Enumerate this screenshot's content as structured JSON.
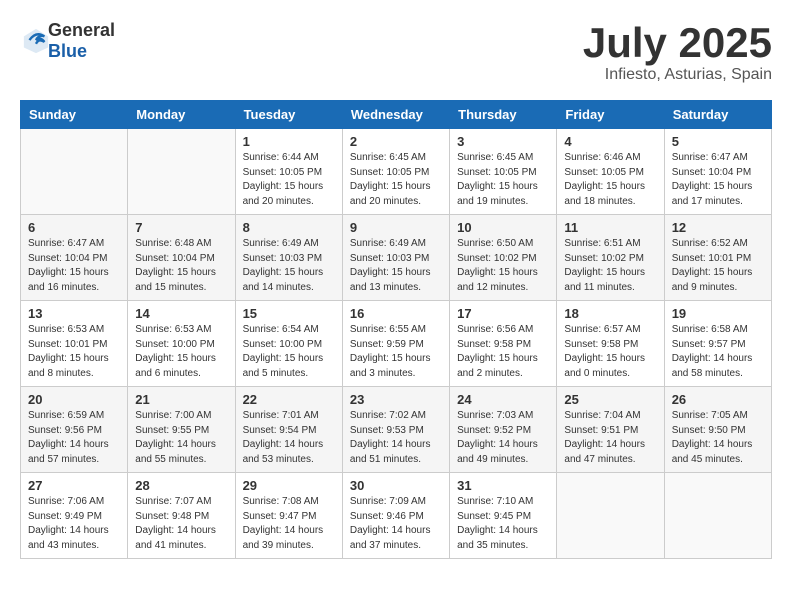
{
  "header": {
    "logo": {
      "text_general": "General",
      "text_blue": "Blue"
    },
    "month": "July 2025",
    "location": "Infiesto, Asturias, Spain"
  },
  "weekdays": [
    "Sunday",
    "Monday",
    "Tuesday",
    "Wednesday",
    "Thursday",
    "Friday",
    "Saturday"
  ],
  "weeks": [
    [
      {
        "day": "",
        "sunrise": "",
        "sunset": "",
        "daylight": ""
      },
      {
        "day": "",
        "sunrise": "",
        "sunset": "",
        "daylight": ""
      },
      {
        "day": "1",
        "sunrise": "Sunrise: 6:44 AM",
        "sunset": "Sunset: 10:05 PM",
        "daylight": "Daylight: 15 hours and 20 minutes."
      },
      {
        "day": "2",
        "sunrise": "Sunrise: 6:45 AM",
        "sunset": "Sunset: 10:05 PM",
        "daylight": "Daylight: 15 hours and 20 minutes."
      },
      {
        "day": "3",
        "sunrise": "Sunrise: 6:45 AM",
        "sunset": "Sunset: 10:05 PM",
        "daylight": "Daylight: 15 hours and 19 minutes."
      },
      {
        "day": "4",
        "sunrise": "Sunrise: 6:46 AM",
        "sunset": "Sunset: 10:05 PM",
        "daylight": "Daylight: 15 hours and 18 minutes."
      },
      {
        "day": "5",
        "sunrise": "Sunrise: 6:47 AM",
        "sunset": "Sunset: 10:04 PM",
        "daylight": "Daylight: 15 hours and 17 minutes."
      }
    ],
    [
      {
        "day": "6",
        "sunrise": "Sunrise: 6:47 AM",
        "sunset": "Sunset: 10:04 PM",
        "daylight": "Daylight: 15 hours and 16 minutes."
      },
      {
        "day": "7",
        "sunrise": "Sunrise: 6:48 AM",
        "sunset": "Sunset: 10:04 PM",
        "daylight": "Daylight: 15 hours and 15 minutes."
      },
      {
        "day": "8",
        "sunrise": "Sunrise: 6:49 AM",
        "sunset": "Sunset: 10:03 PM",
        "daylight": "Daylight: 15 hours and 14 minutes."
      },
      {
        "day": "9",
        "sunrise": "Sunrise: 6:49 AM",
        "sunset": "Sunset: 10:03 PM",
        "daylight": "Daylight: 15 hours and 13 minutes."
      },
      {
        "day": "10",
        "sunrise": "Sunrise: 6:50 AM",
        "sunset": "Sunset: 10:02 PM",
        "daylight": "Daylight: 15 hours and 12 minutes."
      },
      {
        "day": "11",
        "sunrise": "Sunrise: 6:51 AM",
        "sunset": "Sunset: 10:02 PM",
        "daylight": "Daylight: 15 hours and 11 minutes."
      },
      {
        "day": "12",
        "sunrise": "Sunrise: 6:52 AM",
        "sunset": "Sunset: 10:01 PM",
        "daylight": "Daylight: 15 hours and 9 minutes."
      }
    ],
    [
      {
        "day": "13",
        "sunrise": "Sunrise: 6:53 AM",
        "sunset": "Sunset: 10:01 PM",
        "daylight": "Daylight: 15 hours and 8 minutes."
      },
      {
        "day": "14",
        "sunrise": "Sunrise: 6:53 AM",
        "sunset": "Sunset: 10:00 PM",
        "daylight": "Daylight: 15 hours and 6 minutes."
      },
      {
        "day": "15",
        "sunrise": "Sunrise: 6:54 AM",
        "sunset": "Sunset: 10:00 PM",
        "daylight": "Daylight: 15 hours and 5 minutes."
      },
      {
        "day": "16",
        "sunrise": "Sunrise: 6:55 AM",
        "sunset": "Sunset: 9:59 PM",
        "daylight": "Daylight: 15 hours and 3 minutes."
      },
      {
        "day": "17",
        "sunrise": "Sunrise: 6:56 AM",
        "sunset": "Sunset: 9:58 PM",
        "daylight": "Daylight: 15 hours and 2 minutes."
      },
      {
        "day": "18",
        "sunrise": "Sunrise: 6:57 AM",
        "sunset": "Sunset: 9:58 PM",
        "daylight": "Daylight: 15 hours and 0 minutes."
      },
      {
        "day": "19",
        "sunrise": "Sunrise: 6:58 AM",
        "sunset": "Sunset: 9:57 PM",
        "daylight": "Daylight: 14 hours and 58 minutes."
      }
    ],
    [
      {
        "day": "20",
        "sunrise": "Sunrise: 6:59 AM",
        "sunset": "Sunset: 9:56 PM",
        "daylight": "Daylight: 14 hours and 57 minutes."
      },
      {
        "day": "21",
        "sunrise": "Sunrise: 7:00 AM",
        "sunset": "Sunset: 9:55 PM",
        "daylight": "Daylight: 14 hours and 55 minutes."
      },
      {
        "day": "22",
        "sunrise": "Sunrise: 7:01 AM",
        "sunset": "Sunset: 9:54 PM",
        "daylight": "Daylight: 14 hours and 53 minutes."
      },
      {
        "day": "23",
        "sunrise": "Sunrise: 7:02 AM",
        "sunset": "Sunset: 9:53 PM",
        "daylight": "Daylight: 14 hours and 51 minutes."
      },
      {
        "day": "24",
        "sunrise": "Sunrise: 7:03 AM",
        "sunset": "Sunset: 9:52 PM",
        "daylight": "Daylight: 14 hours and 49 minutes."
      },
      {
        "day": "25",
        "sunrise": "Sunrise: 7:04 AM",
        "sunset": "Sunset: 9:51 PM",
        "daylight": "Daylight: 14 hours and 47 minutes."
      },
      {
        "day": "26",
        "sunrise": "Sunrise: 7:05 AM",
        "sunset": "Sunset: 9:50 PM",
        "daylight": "Daylight: 14 hours and 45 minutes."
      }
    ],
    [
      {
        "day": "27",
        "sunrise": "Sunrise: 7:06 AM",
        "sunset": "Sunset: 9:49 PM",
        "daylight": "Daylight: 14 hours and 43 minutes."
      },
      {
        "day": "28",
        "sunrise": "Sunrise: 7:07 AM",
        "sunset": "Sunset: 9:48 PM",
        "daylight": "Daylight: 14 hours and 41 minutes."
      },
      {
        "day": "29",
        "sunrise": "Sunrise: 7:08 AM",
        "sunset": "Sunset: 9:47 PM",
        "daylight": "Daylight: 14 hours and 39 minutes."
      },
      {
        "day": "30",
        "sunrise": "Sunrise: 7:09 AM",
        "sunset": "Sunset: 9:46 PM",
        "daylight": "Daylight: 14 hours and 37 minutes."
      },
      {
        "day": "31",
        "sunrise": "Sunrise: 7:10 AM",
        "sunset": "Sunset: 9:45 PM",
        "daylight": "Daylight: 14 hours and 35 minutes."
      },
      {
        "day": "",
        "sunrise": "",
        "sunset": "",
        "daylight": ""
      },
      {
        "day": "",
        "sunrise": "",
        "sunset": "",
        "daylight": ""
      }
    ]
  ]
}
